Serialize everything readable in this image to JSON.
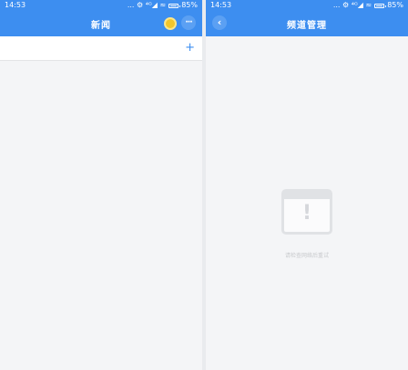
{
  "left_screen": {
    "status": {
      "time": "14:53",
      "icons": "... ⚙ ⁴ᴳ◢ ≈",
      "battery": "85%"
    },
    "title": "新闻",
    "more_label": "···",
    "add_channel_label": "+"
  },
  "right_screen": {
    "status": {
      "time": "14:53",
      "icons": "... ⚙ ⁴ᴳ◢ ≈",
      "battery": "85%"
    },
    "back_label": "‹",
    "title": "频道管理",
    "empty_mark": "!",
    "empty_message": "请检查网络后重试"
  },
  "colors": {
    "accent": "#3d8ef0",
    "background": "#f4f5f7",
    "avatar": "#f3c62b"
  }
}
